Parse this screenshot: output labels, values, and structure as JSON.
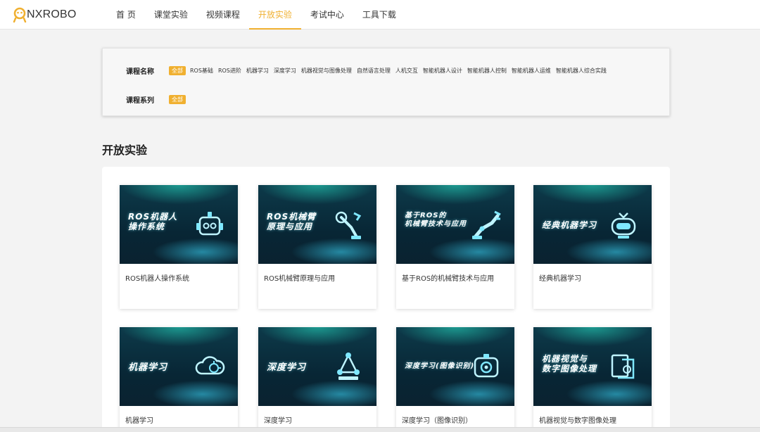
{
  "brand": {
    "name": "NXROBO"
  },
  "nav": {
    "items": [
      {
        "label": "首 页"
      },
      {
        "label": "课堂实验"
      },
      {
        "label": "视频课程"
      },
      {
        "label": "开放实验"
      },
      {
        "label": "考试中心"
      },
      {
        "label": "工具下载"
      }
    ],
    "active_index": 3
  },
  "filters": {
    "course_name": {
      "label": "课程名称",
      "options": [
        "全部",
        "ROS基础",
        "ROS进阶",
        "机器学习",
        "深度学习",
        "机器视觉与图像处理",
        "自然语言处理",
        "人机交互",
        "智能机器人设计",
        "智能机器人控制",
        "智能机器人运维",
        "智能机器人综合实践"
      ],
      "selected": "全部"
    },
    "course_series": {
      "label": "课程系列",
      "options": [
        "全部"
      ],
      "selected": "全部"
    }
  },
  "section": {
    "title": "开放实验"
  },
  "cards": [
    {
      "thumb_lines": [
        "ROS机器人",
        "操作系统"
      ],
      "label": "ROS机器人操作系统",
      "icon": "robot-head-icon"
    },
    {
      "thumb_lines": [
        "ROS机械臂",
        "原理与应用"
      ],
      "label": "ROS机械臂原理与应用",
      "icon": "robot-arm-icon"
    },
    {
      "thumb_lines": [
        "基于ROS的",
        "机械臂技术与应用"
      ],
      "label": "基于ROS的机械臂技术与应用",
      "icon": "industrial-arm-icon"
    },
    {
      "thumb_lines": [
        "经典机器学习"
      ],
      "label": "经典机器学习",
      "icon": "robot-face-icon"
    },
    {
      "thumb_lines": [
        "机器学习"
      ],
      "label": "机器学习",
      "icon": "cloud-brain-icon"
    },
    {
      "thumb_lines": [
        "深度学习"
      ],
      "label": "深度学习",
      "icon": "molecule-icon"
    },
    {
      "thumb_lines": [
        "深度学习(图像识别)"
      ],
      "label": "深度学习（图像识别）",
      "icon": "camera-robot-icon"
    },
    {
      "thumb_lines": [
        "机器视觉与",
        "数字图像处理"
      ],
      "label": "机器视觉与数字图像处理",
      "icon": "image-scan-icon"
    }
  ],
  "colors": {
    "accent": "#f0b030",
    "thumb_bg": "#0a2a38",
    "thumb_glow": "#3ee0d8"
  }
}
